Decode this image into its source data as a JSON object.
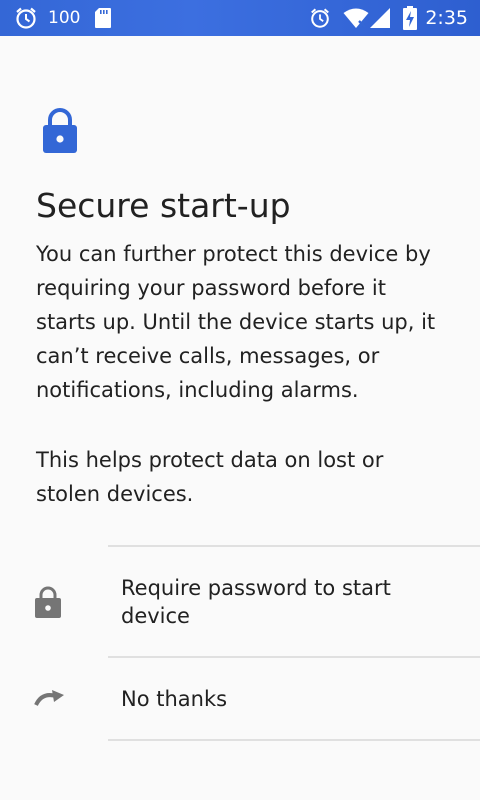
{
  "status_bar": {
    "battery_level": "100",
    "time": "2:35",
    "icons": [
      "alarm-icon",
      "sd-card-icon",
      "alarm-icon",
      "wifi-icon",
      "signal-icon",
      "battery-charging-icon"
    ]
  },
  "hero": {
    "icon": "lock-icon",
    "icon_color": "#3367d6",
    "title": "Secure start-up",
    "body": "You can further protect this device by requiring your password before it starts up. Until the device starts up, it can’t receive calls, messages, or notifications, including alarms.",
    "help": "This helps protect data on lost or stolen devices."
  },
  "options": [
    {
      "icon": "lock-icon",
      "label": "Require password to start device"
    },
    {
      "icon": "redo-arrow-icon",
      "label": "No thanks"
    }
  ],
  "colors": {
    "status_bar": "#3467d6",
    "background": "#fafafa",
    "text": "#212121",
    "option_icon": "#757575",
    "divider": "#e0e0e0"
  }
}
